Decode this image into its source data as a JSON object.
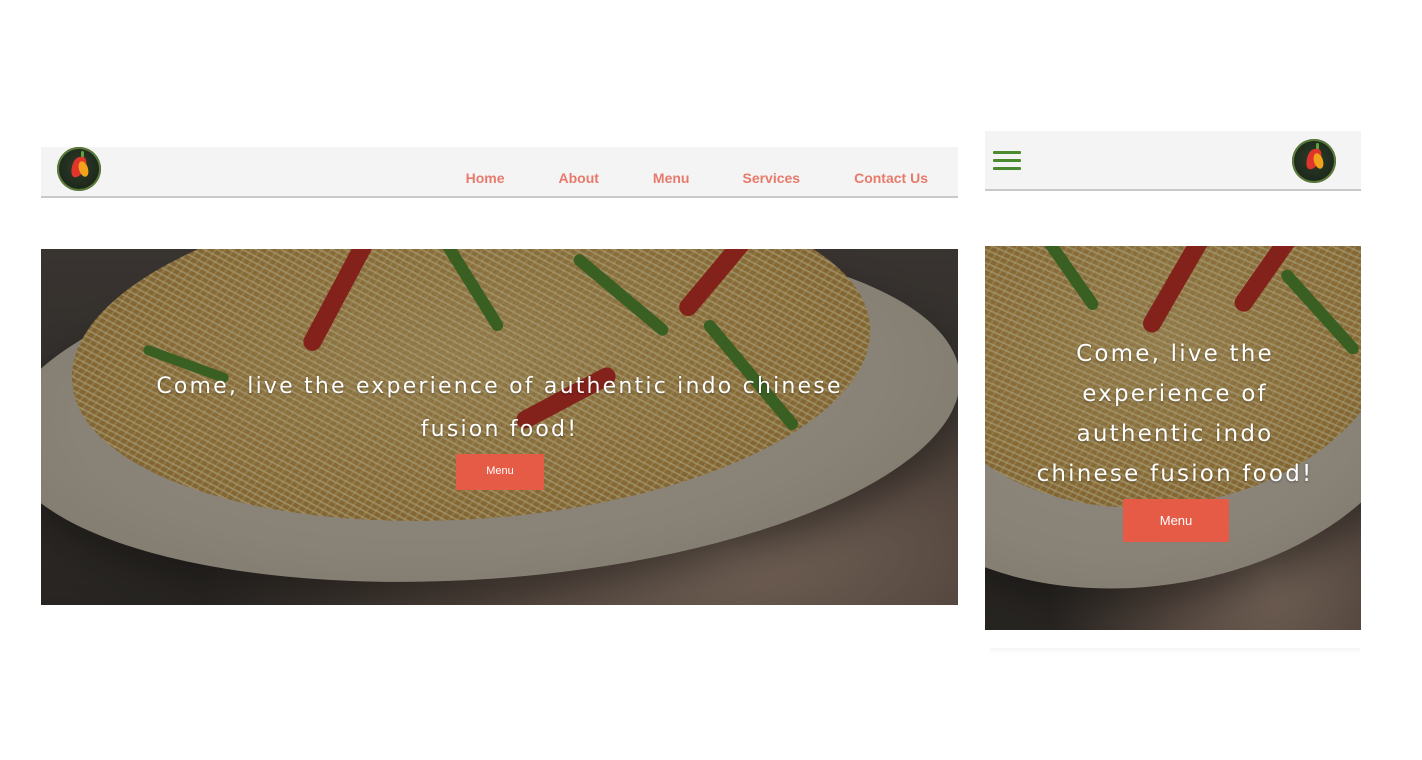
{
  "desktop": {
    "nav": {
      "items": [
        {
          "label": "Home"
        },
        {
          "label": "About"
        },
        {
          "label": "Menu"
        },
        {
          "label": "Services"
        },
        {
          "label": "Contact Us"
        }
      ]
    },
    "hero": {
      "headline": "Come, live the experience of authentic indo chinese fusion food!",
      "button_label": "Menu"
    },
    "logo": {
      "icon": "restaurant-logo-chili-pepper"
    }
  },
  "mobile": {
    "menu_icon": "hamburger-menu-icon",
    "hero": {
      "headline": "Come, live the experience of authentic indo chinese fusion food!",
      "button_label": "Menu"
    },
    "logo": {
      "icon": "restaurant-logo-chili-pepper"
    }
  },
  "colors": {
    "nav_text": "#e87a6c",
    "button": "#e65b45",
    "header_bg": "#f4f4f4",
    "hamburger": "#4c8a2f"
  }
}
